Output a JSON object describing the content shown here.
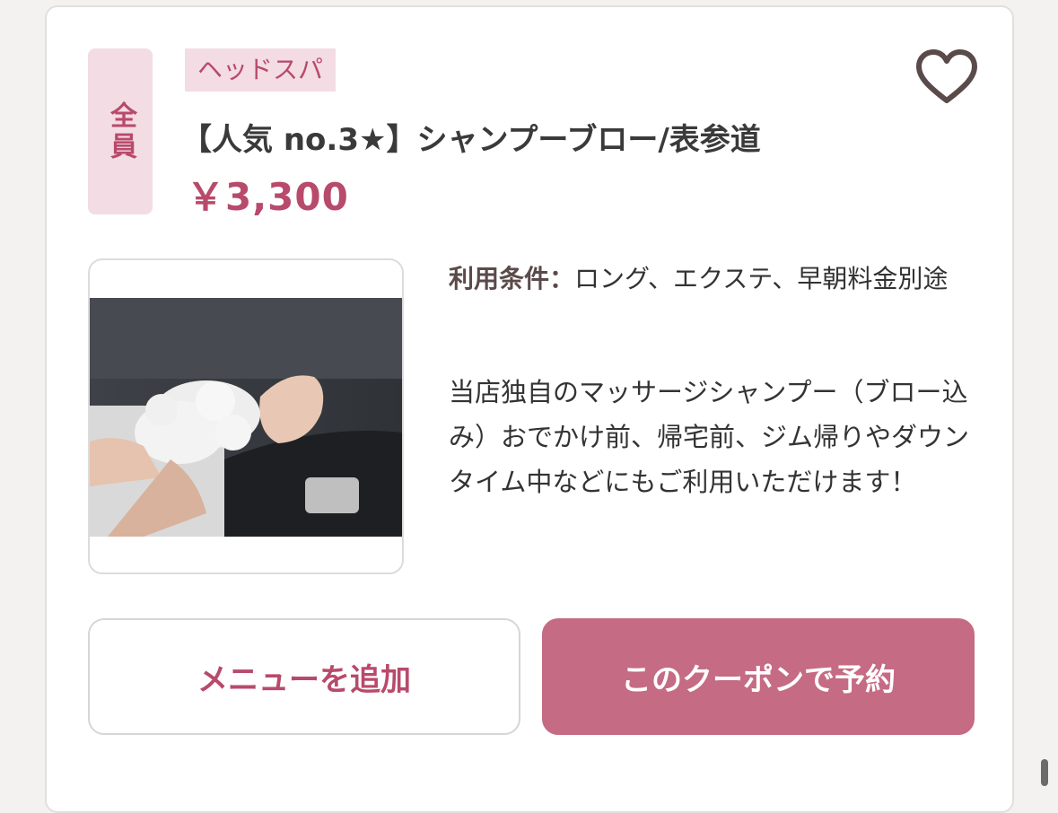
{
  "coupon": {
    "target_label": "全員",
    "category": "ヘッドスパ",
    "title": "【人気 no.3★】シャンプーブロー/表参道",
    "price": "￥3,300",
    "conditions_label": "利用条件：",
    "conditions_value": "ロング、エクステ、早朝料金別途",
    "description": "当店独自のマッサージシャンプー（ブロー込み）おでかけ前、帰宅前、ジム帰りやダウンタイム中などにもご利用いただけます！",
    "favorite_icon": "heart-icon"
  },
  "buttons": {
    "add_menu": "メニューを追加",
    "reserve": "このクーポンで予約"
  },
  "colors": {
    "accent": "#b84a6b",
    "accent_bg": "#f3dce4",
    "reserve_button": "#c56b83"
  }
}
